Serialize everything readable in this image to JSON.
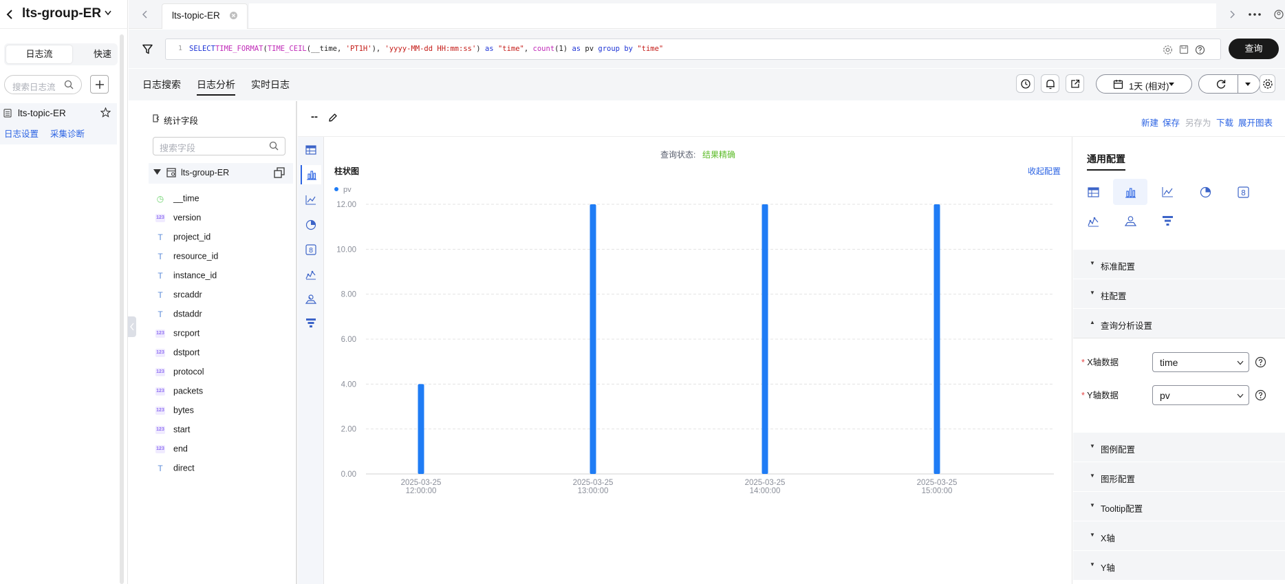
{
  "sidebar": {
    "title": "lts-group-ER",
    "tab_active": "日志流",
    "tab_other": "快速查",
    "search_placeholder": "搜索日志流",
    "stream_name": "lts-topic-ER",
    "link_settings": "日志设置",
    "link_diagnose": "采集诊断"
  },
  "tabs": {
    "active": "lts-topic-ER"
  },
  "query": {
    "line_no": "1",
    "tokens": [
      "SELECT",
      "TIME_FORMAT",
      "(",
      "TIME_CEIL",
      "(__time, ",
      "'PT1H'",
      "), ",
      "'yyyy-MM-dd HH:mm:ss'",
      ") ",
      "as",
      " ",
      "\"time\"",
      ", ",
      "count",
      "(1) ",
      "as",
      " pv ",
      "group by",
      " ",
      "\"time\""
    ],
    "run_label": "查询"
  },
  "subtabs": {
    "search": "日志搜索",
    "analysis": "日志分析",
    "realtime": "实时日志"
  },
  "time_range": "1天 (相对)",
  "fields_panel": {
    "header": "统计字段",
    "search_placeholder": "搜索字段",
    "group": "lts-group-ER",
    "fields": [
      {
        "name": "__time",
        "type": "time"
      },
      {
        "name": "version",
        "type": "num"
      },
      {
        "name": "project_id",
        "type": "txt"
      },
      {
        "name": "resource_id",
        "type": "txt"
      },
      {
        "name": "instance_id",
        "type": "txt"
      },
      {
        "name": "srcaddr",
        "type": "txt"
      },
      {
        "name": "dstaddr",
        "type": "txt"
      },
      {
        "name": "srcport",
        "type": "num"
      },
      {
        "name": "dstport",
        "type": "num"
      },
      {
        "name": "protocol",
        "type": "num"
      },
      {
        "name": "packets",
        "type": "num"
      },
      {
        "name": "bytes",
        "type": "num"
      },
      {
        "name": "start",
        "type": "num"
      },
      {
        "name": "end",
        "type": "num"
      },
      {
        "name": "direct",
        "type": "txt"
      }
    ]
  },
  "chart_toolbar": {
    "name": "--",
    "actions": {
      "new": "新建",
      "save": "保存",
      "save_as": "另存为",
      "download": "下载",
      "expand": "展开图表"
    }
  },
  "query_status": {
    "label": "查询状态:",
    "value": "结果精确"
  },
  "collapse_config": "收起配置",
  "chart_data": {
    "type": "bar",
    "title": "柱状图",
    "categories": [
      "2025-03-25 12:00:00",
      "2025-03-25 13:00:00",
      "2025-03-25 14:00:00",
      "2025-03-25 15:00:00"
    ],
    "category_lines": [
      [
        "2025-03-25",
        "12:00:00"
      ],
      [
        "2025-03-25",
        "13:00:00"
      ],
      [
        "2025-03-25",
        "14:00:00"
      ],
      [
        "2025-03-25",
        "15:00:00"
      ]
    ],
    "series": [
      {
        "name": "pv",
        "values": [
          4,
          12,
          12,
          12
        ],
        "color": "#1f7cf5"
      }
    ],
    "ylim": [
      0,
      12
    ],
    "yticks": [
      "0.00",
      "2.00",
      "4.00",
      "6.00",
      "8.00",
      "10.00",
      "12.00"
    ],
    "grid": true,
    "legend": "top-left"
  },
  "config": {
    "header": "通用配置",
    "sections_top": [
      "标准配置",
      "柱配置",
      "查询分析设置"
    ],
    "x_label": "X轴数据",
    "x_value": "time",
    "y_label": "Y轴数据",
    "y_value": "pv",
    "sections_bottom": [
      "图例配置",
      "图形配置",
      "Tooltip配置",
      "X轴",
      "Y轴"
    ]
  },
  "colors": {
    "accent": "#2b63e3",
    "bar": "#1f7cf5",
    "success": "#5dbc2a"
  }
}
